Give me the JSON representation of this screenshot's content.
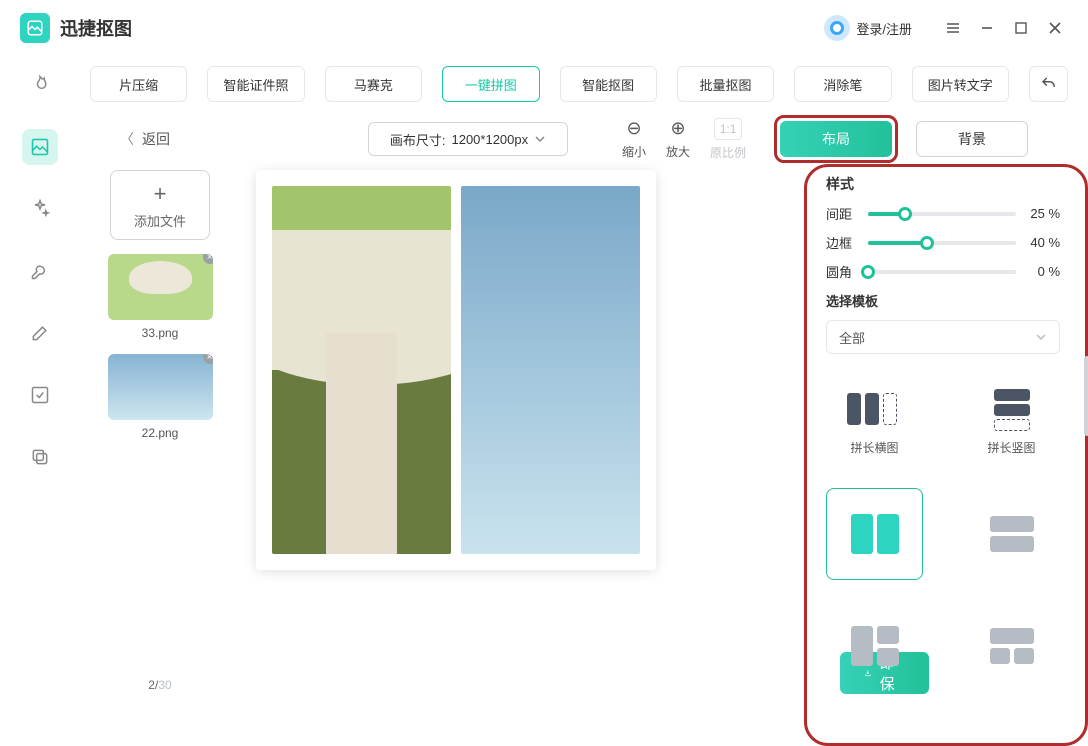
{
  "app": {
    "title": "迅捷抠图",
    "login": "登录/注册"
  },
  "tabs": [
    "片压缩",
    "智能证件照",
    "马赛克",
    "一键拼图",
    "智能抠图",
    "批量抠图",
    "消除笔",
    "图片转文字"
  ],
  "active_tab_index": 3,
  "back_label": "返回",
  "canvas_size": {
    "prefix": "画布尺寸:",
    "value": "1200*1200px"
  },
  "zoom": {
    "out": "缩小",
    "in": "放大",
    "reset": "原比例",
    "ratio": "1:1"
  },
  "segments": {
    "layout": "布局",
    "bg": "背景"
  },
  "files": {
    "add_label": "添加文件",
    "items": [
      {
        "name": "33.png",
        "kind": "mushroom"
      },
      {
        "name": "22.png",
        "kind": "sky"
      }
    ],
    "count_current": 2,
    "count_total": 30
  },
  "panel": {
    "style_heading": "样式",
    "sliders": [
      {
        "label": "间距",
        "value": 25,
        "pct": 25
      },
      {
        "label": "边框",
        "value": 40,
        "pct": 40
      },
      {
        "label": "圆角",
        "value": 0,
        "pct": 0
      }
    ],
    "percent_suffix": "%",
    "template_heading": "选择模板",
    "dropdown_value": "全部",
    "template_labels": {
      "wide": "拼长横图",
      "tall": "拼长竖图"
    }
  },
  "save_label": "立即保存"
}
